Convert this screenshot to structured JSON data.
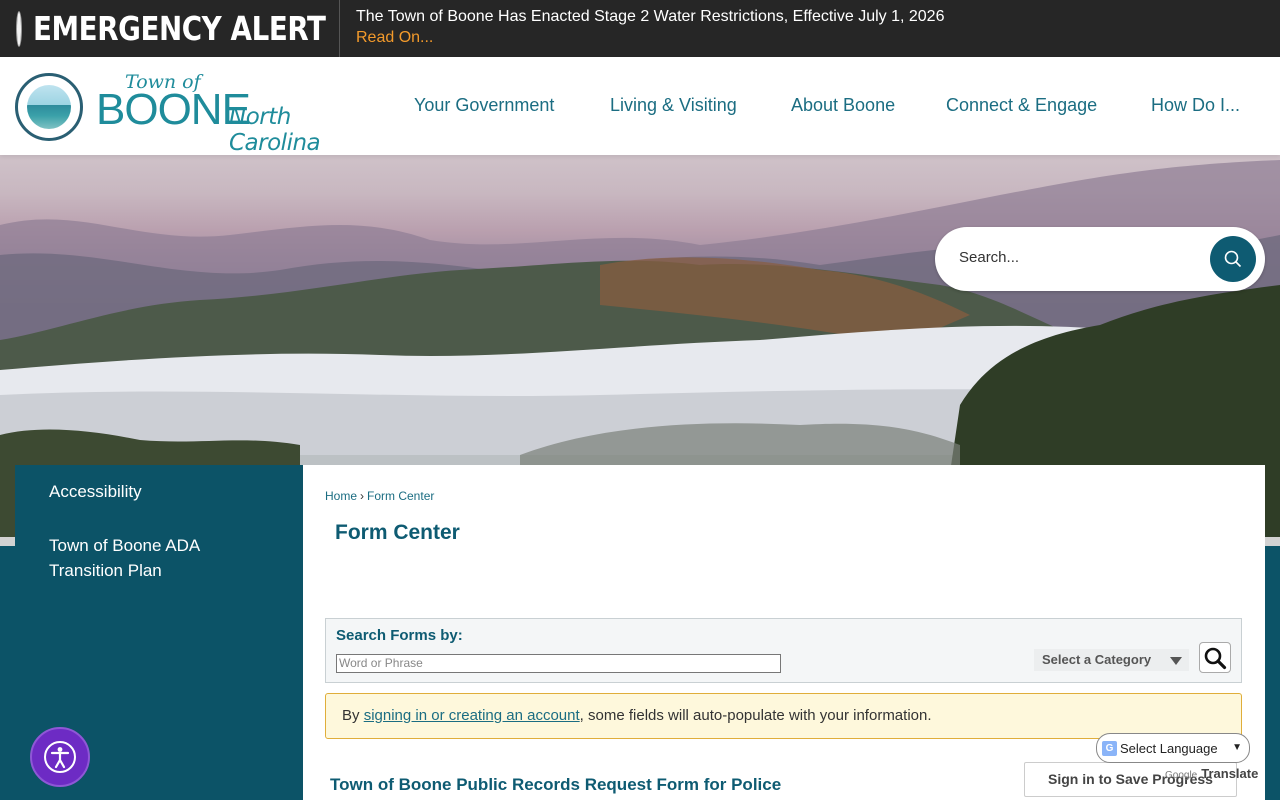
{
  "alert": {
    "title": "EMERGENCY ALERT",
    "message": "The Town of Boone Has Enacted Stage 2 Water Restrictions, Effective July 1, 2026",
    "link": "Read On..."
  },
  "logo": {
    "town_of": "Town of",
    "boone": "BOONE",
    "state": "North Carolina"
  },
  "nav": {
    "items": [
      "Your Government",
      "Living & Visiting",
      "About Boone",
      "Connect & Engage",
      "How Do I..."
    ]
  },
  "site_search": {
    "placeholder": "Search..."
  },
  "sidebar": {
    "items": [
      "Accessibility",
      "Town of Boone ADA Transition Plan"
    ]
  },
  "breadcrumb": {
    "home": "Home",
    "separator": "›",
    "current": "Form Center"
  },
  "page": {
    "title": "Form Center"
  },
  "form_search": {
    "label": "Search Forms by:",
    "placeholder": "Word or Phrase",
    "category": "Select a Category"
  },
  "notice": {
    "prefix": "By ",
    "link": "signing in or creating an account",
    "suffix": ", some fields will auto-populate with your information."
  },
  "form": {
    "title": "Town of Boone Public Records Request Form for Police",
    "save_label": "Sign in to Save Progress"
  },
  "translate": {
    "select_label": "Select Language",
    "powered_prefix": "Google",
    "powered_label": "Translate"
  },
  "colors": {
    "alert_bg": "#262626",
    "alert_link": "#f39a2b",
    "brand_teal": "#0e5b72",
    "logo_teal": "#1f8c9b",
    "notice_bg": "#fef8dc",
    "a11y_purple": "#6d2bc4"
  },
  "icons": {
    "alert": "red-alert-dot-icon",
    "site_search": "search-icon",
    "form_search": "magnifier-icon",
    "category_caret": "chevron-down-icon",
    "accessibility": "accessibility-icon",
    "translate": "google-g-icon"
  }
}
